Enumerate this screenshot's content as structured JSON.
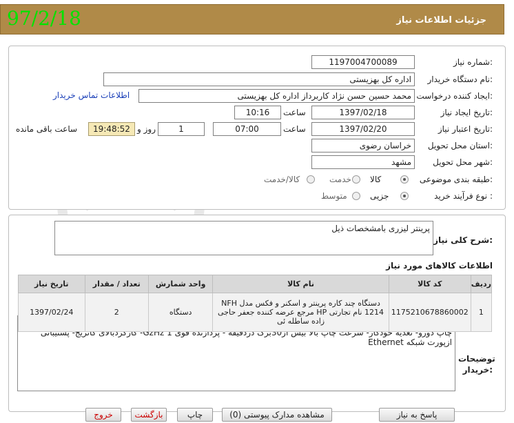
{
  "header": {
    "title": "جزئیات اطلاعات نیاز",
    "date": "97/2/18"
  },
  "form": {
    "need_number": {
      "label": "شماره نیاز:",
      "value": "1197004700089"
    },
    "buyer_org": {
      "label": "نام دستگاه خریدار:",
      "value": "اداره کل بهزیستی"
    },
    "requester": {
      "label": "ایجاد کننده درخواست:",
      "value": "محمد حسین حسن نژاد کاربرداز اداره کل بهزیستی",
      "contact_link": "اطلاعات تماس خریدار"
    },
    "created": {
      "label": "تاریخ ایجاد نیاز:",
      "date": "1397/02/18",
      "time_label": "ساعت",
      "time": "10:16"
    },
    "valid": {
      "label": "تاریخ اعتبار نیاز:",
      "date": "1397/02/20",
      "time_label": "ساعت",
      "time": "07:00",
      "days": "1",
      "days_label": "روز و",
      "remaining": "19:48:52",
      "remaining_label": "ساعت باقی مانده"
    },
    "province": {
      "label": "استان محل تحویل:",
      "value": "خراسان رضوی"
    },
    "city": {
      "label": "شهر محل تحویل:",
      "value": "مشهد"
    },
    "category": {
      "label": "طبقه بندی موضوعی:",
      "options": [
        "کالا",
        "خدمت",
        "کالا/خدمت"
      ],
      "selected": "کالا"
    },
    "process": {
      "label": "نوع فرآیند خرید :",
      "options": [
        "جزیی",
        "متوسط"
      ],
      "selected": "جزیی"
    }
  },
  "summary": {
    "label": "شرح کلی نیاز:",
    "value": "پرینتر لیزری بامشخصات ذیل"
  },
  "goods": {
    "title": "اطلاعات کالاهای مورد نیاز",
    "columns": [
      "ردیف",
      "کد کالا",
      "نام کالا",
      "واحد شمارش",
      "تعداد / مقدار",
      "تاریخ نیاز"
    ],
    "rows": [
      {
        "row": "1",
        "code": "1175210678860002",
        "name": "دستگاه چند کاره پرینتر و اسکنر و فکس مدل NFH 1214 نام تجارتی HP مرجع عرضه کننده جعفر حاجی زاده ساطله ئی",
        "unit": "دستگاه",
        "qty": "2",
        "date": "1397/02/24"
      }
    ]
  },
  "notes": {
    "label": "توضیحات خریدار:",
    "value": "ایران کدمشابه است - برندومشخصات توسط تامین کننده باید اعلام شود- مشخصات پرینتر :پرینتر لیزری تک رنگ - باقابلیت چاپ دورو- تغذیه خودکار- سرعت چاپ بالا بیش از30برگ دردقیقه - پردازنده قوی GzHz 1- کارکردبالای کاتریج- پشتیبانی ازپورت شبکه Ethernet"
  },
  "buttons": {
    "reply": "پاسخ به نیاز",
    "attachments": "مشاهده مدارک پیوستی (0)",
    "print": "چاپ",
    "back": "بازگشت",
    "exit": "خروج"
  },
  "colors": {
    "header_bg": "#b08a48",
    "date_green": "#00e400",
    "timer_bg": "#f6e9b6",
    "link_blue": "#1a3fb8"
  }
}
